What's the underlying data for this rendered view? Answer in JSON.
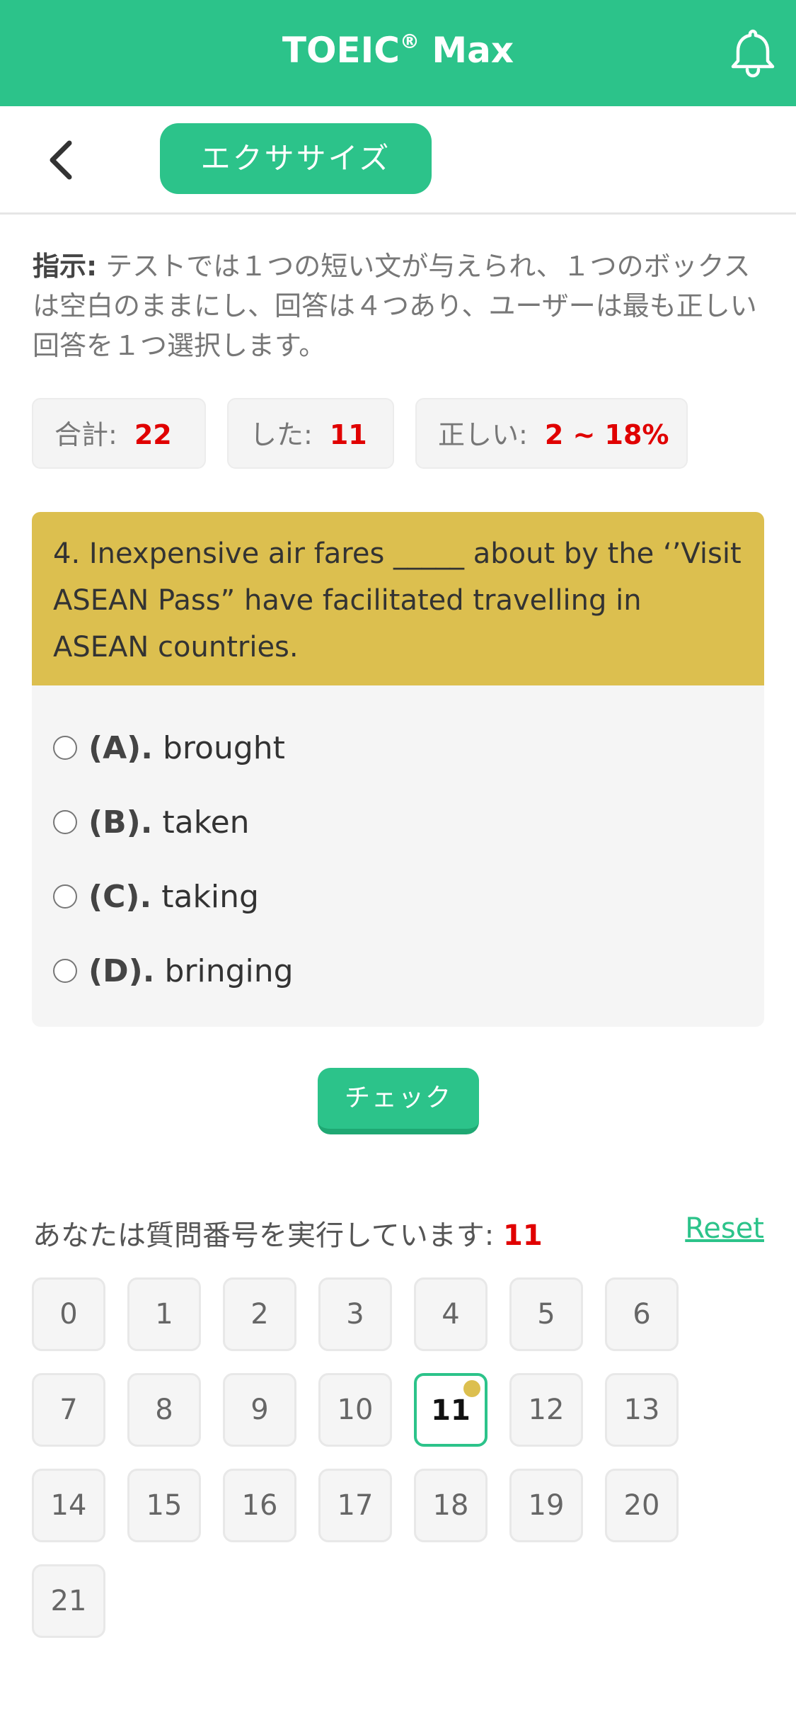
{
  "header": {
    "title": "TOEIC",
    "title_reg": "®",
    "title_suffix": " Max",
    "bell_icon": "bell-icon",
    "color": "#2cc38a"
  },
  "subbar": {
    "back_icon": "chevron-left-icon",
    "exercise_label": "エクササイズ"
  },
  "instruction": {
    "label": "指示:",
    "text": " テストでは１つの短い文が与えられ、１つのボックスは空白のままにし、回答は４つあり、ユーザーは最も正しい回答を１つ選択します。"
  },
  "stats": [
    {
      "label": "合計:",
      "value": "22"
    },
    {
      "label": "した:",
      "value": "11"
    },
    {
      "label": "正しい:",
      "value": "2 ~ 18%"
    }
  ],
  "question": {
    "text": "4. Inexpensive air fares _____ about by the ‘’Visit ASEAN Pass” have facilitated travelling in ASEAN countries.",
    "options": [
      {
        "letter": "(A).",
        "text": "brought"
      },
      {
        "letter": "(B).",
        "text": "taken"
      },
      {
        "letter": "(C).",
        "text": "taking"
      },
      {
        "letter": "(D).",
        "text": "bringing"
      }
    ]
  },
  "check_label": "チェック",
  "progress": {
    "label": "あなたは質問番号を実行しています: ",
    "current": "11",
    "reset_label": "Reset"
  },
  "grid": {
    "numbers": [
      "0",
      "1",
      "2",
      "3",
      "4",
      "5",
      "6",
      "7",
      "8",
      "9",
      "10",
      "11",
      "12",
      "13",
      "14",
      "15",
      "16",
      "17",
      "18",
      "19",
      "20",
      "21"
    ],
    "current_index": 11,
    "accent": "#dcbf4f"
  }
}
